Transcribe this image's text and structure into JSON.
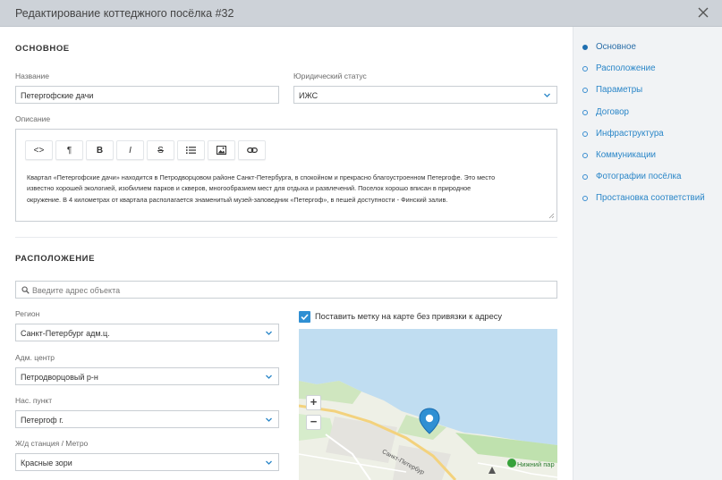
{
  "window": {
    "title": "Редактирование коттеджного посёлка #32",
    "close_icon": "close-icon"
  },
  "basic": {
    "section_title": "ОСНОВНОЕ",
    "name_label": "Название",
    "name_value": "Петергофские дачи",
    "legal_label": "Юридический статус",
    "legal_value": "ИЖС",
    "description_label": "Описание",
    "toolbar": {
      "code": "<>",
      "paragraph": "¶",
      "bold": "B",
      "italic": "I",
      "strike": "S",
      "list_icon": "list-icon",
      "image_icon": "image-icon",
      "link_icon": "link-icon"
    },
    "description_lines": [
      "Квартал «Петергофские дачи» находится в Петродворцовом районе Санкт-Петербурга, в спокойном и прекрасно благоустроенном Петергофе. Это место",
      "известно хорошей экологией, изобилием парков и скверов, многообразием мест для отдыха и развлечений. Поселок хорошо вписан в природное",
      "окружение. В 4 километрах от квартала располагается знаменитый музей-заповедник «Петергоф», в пешей доступности - Финский залив."
    ]
  },
  "location": {
    "section_title": "РАСПОЛОЖЕНИЕ",
    "search_placeholder": "Введите адрес объекта",
    "region_label": "Регион",
    "region_value": "Санкт-Петербург адм.ц.",
    "admin_label": "Адм. центр",
    "admin_value": "Петродворцовый р-н",
    "settlement_label": "Нас. пункт",
    "settlement_value": "Петергоф г.",
    "station_label": "Ж/д станция / Метро",
    "station_value": "Красные зори",
    "checkbox_label": "Поставить метку на карте без привязки к адресу",
    "checkbox_checked": true,
    "map": {
      "zoom_in": "+",
      "zoom_out": "−",
      "road_label": "Санкт-Петербур",
      "park_label": "Нижний пар"
    }
  },
  "nav": {
    "items": [
      {
        "label": "Основное",
        "active": true
      },
      {
        "label": "Расположение",
        "active": false
      },
      {
        "label": "Параметры",
        "active": false
      },
      {
        "label": "Договор",
        "active": false
      },
      {
        "label": "Инфраструктура",
        "active": false
      },
      {
        "label": "Коммуникации",
        "active": false
      },
      {
        "label": "Фотографии посёлка",
        "active": false
      },
      {
        "label": "Простановка соответствий",
        "active": false
      }
    ]
  },
  "colors": {
    "accent": "#2a86c8",
    "checkbox": "#2f8fd3",
    "titlebar": "#cdd2d8",
    "water": "#c0ddf1"
  }
}
